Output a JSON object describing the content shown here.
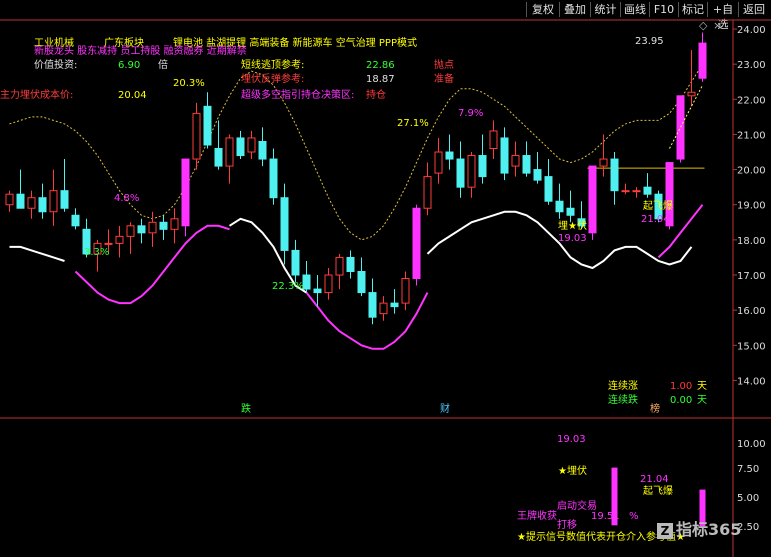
{
  "toolbar": {
    "items": [
      "复权",
      "叠加",
      "统计",
      "画线",
      "F10",
      "标记",
      "+自选",
      "返回"
    ],
    "settings_glyph": "◇"
  },
  "header": {
    "row1": [
      "工业机械",
      "广东板块",
      "锂电池 盐湖提锂 高端装备 新能源车 空气治理 PPP模式"
    ],
    "row2": "新股龙头 股东减持 员工持股 融资融券 近期解禁",
    "value_label": "价值投资:",
    "value_num": "6.90",
    "value_unit": "倍",
    "cost_label": "主力埋伏成本价:",
    "cost_value": "20.04",
    "short_top_label": "短线逃顶参考:",
    "short_top_value": "22.86",
    "short_top_tag": "抛点",
    "ambush_label": "埋伏反弹参考:",
    "ambush_value": "18.87",
    "ambush_tag": "准备",
    "super_label": "超级多空指引持仓决策区:",
    "super_tag": "持仓"
  },
  "annotations": {
    "pct_33": "3.3%",
    "pct_48": "4.8%",
    "pct_203": "20.3%",
    "pct_223": "22.3%",
    "pct_271": "27.1%",
    "pct_79": "7.9%",
    "price_2395": "23.95",
    "maifu_text": "埋★伏",
    "maifu_price": "19.03",
    "qifei_text": "起飞爆",
    "qifei_price": "21.04",
    "lianxu_zhang_label": "连续涨",
    "lianxu_zhang_value": "1.00",
    "lianxu_zhang_unit": "天",
    "lianxu_die_label": "连续跌",
    "lianxu_die_value": "0.00",
    "lianxu_die_unit": "天",
    "marker_die": "跌",
    "marker_cai": "财",
    "marker_zhang": "榜"
  },
  "sub_panel": {
    "price_1903": "19.03",
    "maifu": "★埋伏",
    "price_2104": "21.04",
    "qifei": "起飞爆",
    "qidong": "启动交易",
    "wangpai": "王牌收获",
    "value_1951": "19.51",
    "pct_sign": "%",
    "dengdeng": "打移",
    "footer_text": "★提示信号数值代表开仓介入参考值★",
    "axis": [
      "10.00",
      "7.50",
      "5.00",
      "2.50"
    ]
  },
  "watermark": {
    "icon": "Z",
    "text": "指标365"
  },
  "colors": {
    "up": "#ff3b3b",
    "down": "#4ff0f0",
    "magenta": "#ff33ff",
    "yellow": "#ffff00",
    "dash": "#e0c040"
  },
  "chart_data": {
    "type": "candlestick",
    "ylim": [
      13.5,
      24.2
    ],
    "yticks": [
      14.0,
      15.0,
      16.0,
      17.0,
      18.0,
      19.0,
      20.0,
      21.0,
      22.0,
      23.0,
      24.0
    ],
    "candles": [
      [
        19.0,
        19.4,
        18.8,
        19.3
      ],
      [
        19.3,
        20.0,
        18.9,
        18.9
      ],
      [
        18.9,
        19.4,
        18.6,
        19.2
      ],
      [
        19.2,
        19.6,
        18.6,
        18.8
      ],
      [
        18.8,
        20.0,
        18.4,
        19.4
      ],
      [
        19.4,
        20.3,
        18.8,
        18.9
      ],
      [
        18.7,
        18.9,
        18.3,
        18.4
      ],
      [
        18.3,
        18.6,
        17.5,
        17.6
      ],
      [
        17.6,
        18.0,
        17.1,
        17.9
      ],
      [
        17.9,
        18.3,
        17.6,
        17.9
      ],
      [
        17.9,
        18.4,
        17.5,
        18.1
      ],
      [
        18.1,
        18.5,
        17.6,
        18.4
      ],
      [
        18.4,
        18.6,
        17.9,
        18.2
      ],
      [
        18.2,
        18.8,
        17.8,
        18.5
      ],
      [
        18.5,
        18.7,
        18.0,
        18.3
      ],
      [
        18.3,
        18.9,
        17.9,
        18.6
      ],
      [
        18.4,
        20.3,
        18.1,
        20.3
      ],
      [
        20.3,
        21.9,
        20.0,
        21.6
      ],
      [
        21.8,
        22.2,
        20.6,
        20.7
      ],
      [
        20.6,
        21.4,
        20.0,
        20.1
      ],
      [
        20.1,
        21.0,
        19.6,
        20.9
      ],
      [
        20.9,
        21.1,
        20.3,
        20.4
      ],
      [
        20.5,
        21.1,
        20.3,
        20.9
      ],
      [
        20.8,
        21.2,
        20.1,
        20.3
      ],
      [
        20.3,
        20.6,
        19.0,
        19.2
      ],
      [
        19.2,
        19.6,
        17.3,
        17.7
      ],
      [
        17.7,
        18.0,
        16.8,
        17.0
      ],
      [
        17.0,
        17.4,
        16.5,
        16.6
      ],
      [
        16.6,
        17.0,
        16.1,
        16.5
      ],
      [
        16.5,
        17.2,
        16.3,
        17.0
      ],
      [
        17.0,
        17.6,
        16.6,
        17.5
      ],
      [
        17.5,
        17.7,
        16.9,
        17.1
      ],
      [
        17.1,
        17.5,
        16.4,
        16.5
      ],
      [
        16.5,
        16.9,
        15.6,
        15.8
      ],
      [
        15.9,
        16.4,
        15.7,
        16.2
      ],
      [
        16.2,
        16.6,
        15.9,
        16.1
      ],
      [
        16.2,
        17.1,
        16.0,
        16.9
      ],
      [
        16.9,
        19.0,
        16.7,
        18.9
      ],
      [
        18.9,
        20.2,
        18.7,
        19.8
      ],
      [
        19.9,
        20.9,
        19.6,
        20.5
      ],
      [
        20.5,
        21.0,
        20.0,
        20.3
      ],
      [
        20.3,
        20.8,
        19.2,
        19.5
      ],
      [
        19.5,
        20.5,
        19.2,
        20.4
      ],
      [
        20.4,
        21.0,
        19.6,
        19.8
      ],
      [
        20.6,
        21.4,
        20.3,
        21.1
      ],
      [
        20.9,
        21.2,
        19.7,
        19.9
      ],
      [
        20.1,
        20.8,
        19.8,
        20.4
      ],
      [
        20.4,
        20.8,
        19.8,
        19.9
      ],
      [
        20.0,
        20.5,
        19.6,
        19.7
      ],
      [
        19.8,
        20.3,
        19.0,
        19.1
      ],
      [
        19.1,
        19.6,
        18.6,
        18.8
      ],
      [
        18.9,
        19.4,
        18.5,
        18.7
      ],
      [
        18.6,
        19.1,
        18.3,
        18.4
      ],
      [
        18.2,
        20.1,
        18.0,
        20.1
      ],
      [
        20.1,
        21.0,
        19.8,
        20.3
      ],
      [
        20.3,
        20.5,
        19.0,
        19.4
      ],
      [
        19.4,
        19.6,
        19.3,
        19.4
      ],
      [
        19.4,
        19.5,
        19.2,
        19.4
      ],
      [
        19.5,
        19.9,
        19.2,
        19.3
      ],
      [
        19.3,
        19.4,
        18.5,
        18.6
      ],
      [
        18.4,
        20.2,
        18.3,
        20.2
      ],
      [
        20.3,
        22.1,
        20.2,
        22.1
      ],
      [
        22.1,
        23.4,
        21.8,
        22.2
      ],
      [
        22.6,
        23.9,
        22.5,
        23.6
      ]
    ],
    "bull_bars": [
      16,
      37,
      53,
      60,
      61,
      63
    ],
    "bear_bars": [
      24
    ],
    "cost_line": 20.04,
    "upper_dashed": [
      21.3,
      21.4,
      21.5,
      21.5,
      21.4,
      21.3,
      21.1,
      20.8,
      20.4,
      19.9,
      19.4,
      19.0,
      18.7,
      18.6,
      18.7,
      19.0,
      19.5,
      20.1,
      20.8,
      21.5,
      22.1,
      22.6,
      22.8,
      22.7,
      22.4,
      21.9,
      21.3,
      20.6,
      19.9,
      19.2,
      18.6,
      18.2,
      18.0,
      18.1,
      18.4,
      18.9,
      19.5,
      20.2,
      20.9,
      21.5,
      22.0,
      22.3,
      22.3,
      22.2,
      22.0,
      21.8,
      21.5,
      21.2,
      20.9,
      20.6,
      20.3,
      20.2,
      20.3,
      20.5,
      20.8,
      21.1,
      21.3,
      21.4,
      21.4,
      21.4,
      21.6,
      22.0,
      22.5,
      23.0
    ],
    "lower_white": [
      17.8,
      17.8,
      17.7,
      17.6,
      17.5,
      17.4,
      null,
      null,
      null,
      null,
      null,
      null,
      null,
      null,
      null,
      null,
      null,
      null,
      null,
      null,
      18.4,
      18.6,
      18.5,
      18.2,
      17.8,
      17.2,
      16.7,
      16.5,
      null,
      null,
      null,
      null,
      null,
      null,
      null,
      null,
      null,
      null,
      17.6,
      17.9,
      18.1,
      18.3,
      18.5,
      18.6,
      18.7,
      18.8,
      18.8,
      18.7,
      18.5,
      18.2,
      17.9,
      17.5,
      17.3,
      17.2,
      17.4,
      17.7,
      17.8,
      17.8,
      17.6,
      17.4,
      17.3,
      17.4,
      17.8,
      null
    ],
    "lower_magenta": [
      null,
      null,
      null,
      null,
      null,
      null,
      17.1,
      16.8,
      16.5,
      16.3,
      16.2,
      16.2,
      16.4,
      16.7,
      17.1,
      17.5,
      17.9,
      18.2,
      18.4,
      18.4,
      18.3,
      null,
      null,
      null,
      null,
      null,
      null,
      16.5,
      16.1,
      15.7,
      15.4,
      15.2,
      15.0,
      14.9,
      14.9,
      15.1,
      15.4,
      15.9,
      16.5,
      null,
      null,
      null,
      null,
      null,
      null,
      null,
      null,
      null,
      null,
      null,
      null,
      null,
      null,
      null,
      null,
      null,
      null,
      null,
      null,
      17.5,
      17.8,
      18.2,
      18.6,
      19.0
    ],
    "short_ma": [
      null,
      null,
      null,
      null,
      null,
      null,
      null,
      null,
      null,
      null,
      null,
      null,
      null,
      null,
      null,
      null,
      null,
      null,
      null,
      null,
      null,
      null,
      null,
      null,
      null,
      null,
      null,
      null,
      null,
      null,
      null,
      null,
      null,
      null,
      null,
      null,
      null,
      null,
      null,
      null,
      null,
      null,
      null,
      null,
      null,
      null,
      null,
      null,
      null,
      null,
      null,
      null,
      null,
      null,
      null,
      null,
      null,
      null,
      null,
      null,
      20.6,
      21.2,
      21.8,
      22.4
    ],
    "sub_bars": [
      [
        55,
        7.9,
        1.6
      ],
      [
        63,
        5.5,
        1.5
      ]
    ]
  }
}
